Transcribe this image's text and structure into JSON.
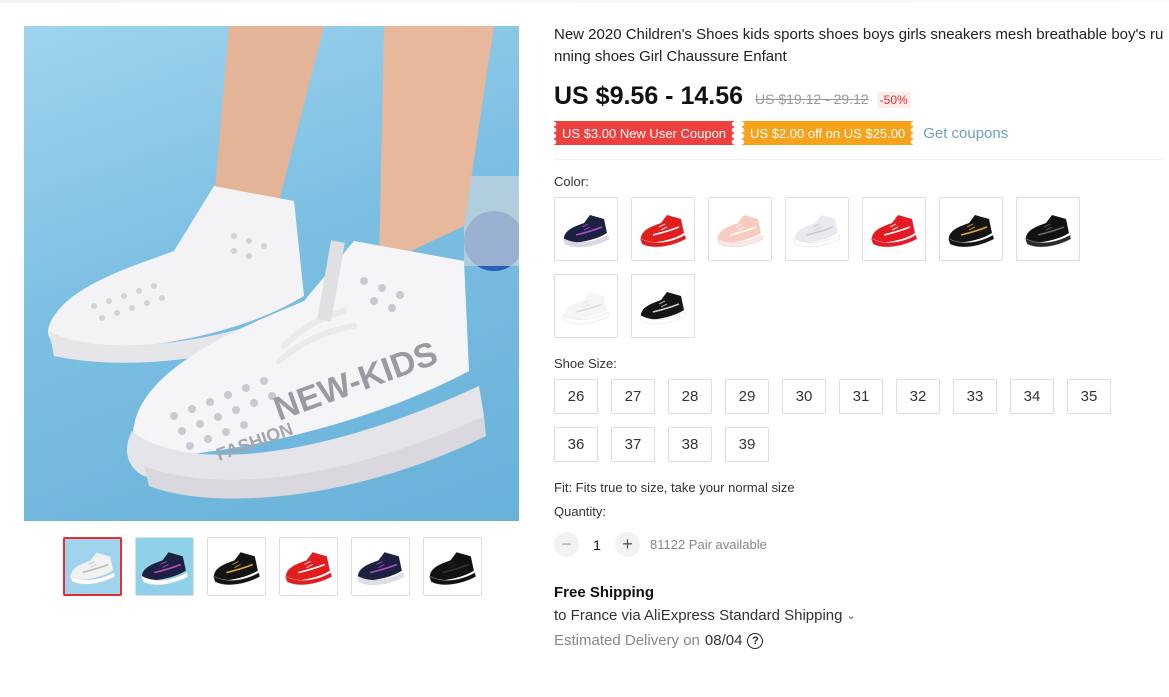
{
  "product": {
    "title": "New 2020 Children's Shoes kids sports shoes boys girls sneakers mesh breathable boy's running shoes Girl Chaussure Enfant",
    "price": "US $9.56 - 14.56",
    "original_price": "US $19.12 - 29.12",
    "discount": "-50%"
  },
  "coupons": {
    "new_user": "US $3.00 New User Coupon",
    "store": "US $2.00 off on US $25.00",
    "get_link": "Get coupons"
  },
  "color": {
    "label": "Color:",
    "options": [
      {
        "icon": "navy-sneaker-icon",
        "body": "#1c2140",
        "sole": "#d9d9e6",
        "accent": "#b04bd0"
      },
      {
        "icon": "red-sneaker-icon",
        "body": "#e21d1d",
        "sole": "#e21d1d",
        "accent": "#ffffff"
      },
      {
        "icon": "pink-sneaker-icon",
        "body": "#f7cbbf",
        "sole": "#fde8e1",
        "accent": "#ffffff"
      },
      {
        "icon": "white-grey-sneaker-icon",
        "body": "#e9e9ef",
        "sole": "#ffffff",
        "accent": "#c8c8d0"
      },
      {
        "icon": "red-sneaker-icon",
        "body": "#e51b24",
        "sole": "#e51b24",
        "accent": "#ffffff"
      },
      {
        "icon": "black-gold-sneaker-icon",
        "body": "#141414",
        "sole": "#141414",
        "accent": "#d9a93a"
      },
      {
        "icon": "black-sneaker-icon",
        "body": "#111111",
        "sole": "#2a2a2a",
        "accent": "#666666"
      },
      {
        "icon": "white-sneaker-icon",
        "body": "#f5f5f5",
        "sole": "#ffffff",
        "accent": "#dddddd"
      },
      {
        "icon": "black-white-sneaker-icon",
        "body": "#141414",
        "sole": "#ffffff",
        "accent": "#cccccc"
      }
    ]
  },
  "size": {
    "label": "Shoe Size:",
    "options": [
      "26",
      "27",
      "28",
      "29",
      "30",
      "31",
      "32",
      "33",
      "34",
      "35",
      "36",
      "37",
      "38",
      "39"
    ]
  },
  "fit": "Fit: Fits true to size, take your normal size",
  "quantity": {
    "label": "Quantity:",
    "value": "1",
    "minus": "−",
    "plus": "+",
    "available": "81122 Pair available"
  },
  "shipping": {
    "title": "Free Shipping",
    "via": "to France via AliExpress Standard Shipping",
    "delivery_label": "Estimated Delivery on",
    "delivery_date": "08/04",
    "help_icon": "?"
  },
  "gallery": {
    "main_text": "NEW-KIDS",
    "main_sub": "FASHION",
    "thumbnails": [
      {
        "icon": "white-sneaker-on-feet-icon",
        "bg": "#9fd3ee",
        "body": "#f2f2f2",
        "sole": "#ffffff",
        "accent": "#bbbbbb"
      },
      {
        "icon": "navy-sneaker-on-feet-icon",
        "bg": "#8fd0ea",
        "body": "#1c2140",
        "sole": "#ffffff",
        "accent": "#c04bd0"
      },
      {
        "icon": "black-gold-sneaker-icon",
        "bg": "#ffffff",
        "body": "#141414",
        "sole": "#141414",
        "accent": "#d9a93a"
      },
      {
        "icon": "red-sneaker-icon",
        "bg": "#ffffff",
        "body": "#e21d1d",
        "sole": "#e21d1d",
        "accent": "#ffffff"
      },
      {
        "icon": "navy-purple-sneaker-icon",
        "bg": "#ffffff",
        "body": "#1c2140",
        "sole": "#dedee8",
        "accent": "#b04bd0"
      },
      {
        "icon": "black-sole-icon",
        "bg": "#ffffff",
        "body": "#111111",
        "sole": "#111111",
        "accent": "#333333"
      }
    ]
  }
}
